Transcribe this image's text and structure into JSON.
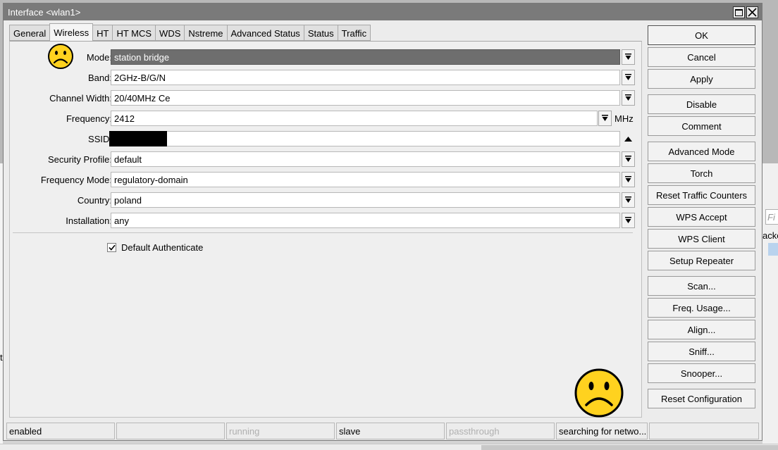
{
  "window": {
    "title": "Interface <wlan1>"
  },
  "tabs": [
    {
      "label": "General",
      "active": false
    },
    {
      "label": "Wireless",
      "active": true
    },
    {
      "label": "HT",
      "active": false
    },
    {
      "label": "HT MCS",
      "active": false
    },
    {
      "label": "WDS",
      "active": false
    },
    {
      "label": "Nstreme",
      "active": false
    },
    {
      "label": "Advanced Status",
      "active": false
    },
    {
      "label": "Status",
      "active": false
    },
    {
      "label": "Traffic",
      "active": false
    }
  ],
  "form": {
    "mode": {
      "label": "Mode:",
      "value": "station bridge"
    },
    "band": {
      "label": "Band:",
      "value": "2GHz-B/G/N"
    },
    "channel_width": {
      "label": "Channel Width:",
      "value": "20/40MHz Ce"
    },
    "frequency": {
      "label": "Frequency:",
      "value": "2412",
      "unit": "MHz"
    },
    "ssid": {
      "label": "SSID:",
      "value": ""
    },
    "security_profile": {
      "label": "Security Profile:",
      "value": "default"
    },
    "frequency_mode": {
      "label": "Frequency Mode:",
      "value": "regulatory-domain"
    },
    "country": {
      "label": "Country:",
      "value": "poland"
    },
    "installation": {
      "label": "Installation:",
      "value": "any"
    },
    "default_authenticate": {
      "label": "Default Authenticate",
      "checked": true
    }
  },
  "buttons": {
    "ok": "OK",
    "cancel": "Cancel",
    "apply": "Apply",
    "disable": "Disable",
    "comment": "Comment",
    "advanced_mode": "Advanced Mode",
    "torch": "Torch",
    "reset_traffic_counters": "Reset Traffic Counters",
    "wps_accept": "WPS Accept",
    "wps_client": "WPS Client",
    "setup_repeater": "Setup Repeater",
    "scan": "Scan...",
    "freq_usage": "Freq. Usage...",
    "align": "Align...",
    "sniff": "Sniff...",
    "snooper": "Snooper...",
    "reset_configuration": "Reset Configuration"
  },
  "statusbar": {
    "enabled": "enabled",
    "empty": "",
    "running": "running",
    "slave": "slave",
    "passthrough": "passthrough",
    "searching": "searching for netwo..."
  },
  "background": {
    "filter_placeholder": "Fi",
    "partial_text": "acke",
    "left_char": "ti"
  },
  "colors": {
    "titlebar": "#7a7a7a",
    "selected_field": "#6e6e6e",
    "emoji_face": "#ffd21f"
  },
  "icons": {
    "dropdown": "down-arrow-bar-icon",
    "collapse": "up-triangle-icon",
    "checkbox": "checkmark-icon",
    "emoji": "sad-face-icon"
  }
}
